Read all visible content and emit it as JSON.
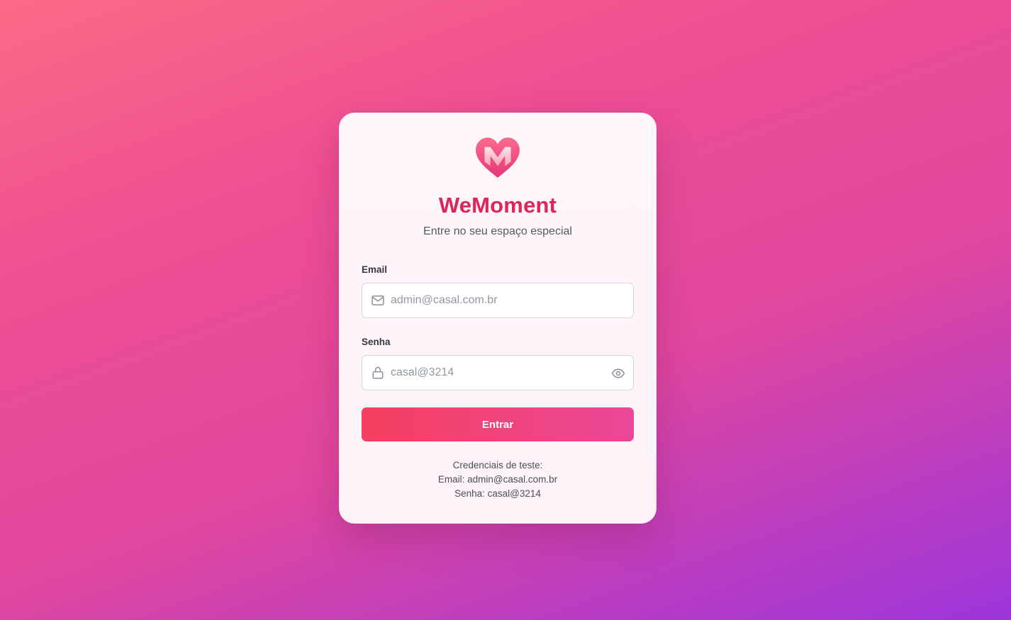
{
  "app": {
    "name": "WeMoment",
    "subtitle": "Entre no seu espaço especial",
    "logo_icon": "heart-m-logo"
  },
  "form": {
    "email": {
      "label": "Email",
      "placeholder": "admin@casal.com.br",
      "value": "",
      "icon": "mail-icon"
    },
    "password": {
      "label": "Senha",
      "placeholder": "casal@3214",
      "value": "",
      "icon": "lock-icon",
      "toggle_icon": "eye-icon"
    },
    "submit_label": "Entrar"
  },
  "test_credentials": {
    "heading": "Credenciais de teste:",
    "email_line": "Email: admin@casal.com.br",
    "password_line": "Senha: casal@3214"
  },
  "colors": {
    "brand": "#de2459",
    "button_start": "#f43f5e",
    "button_end": "#ec4899",
    "background_start": "#fb6a86",
    "background_end": "#9d35db"
  }
}
